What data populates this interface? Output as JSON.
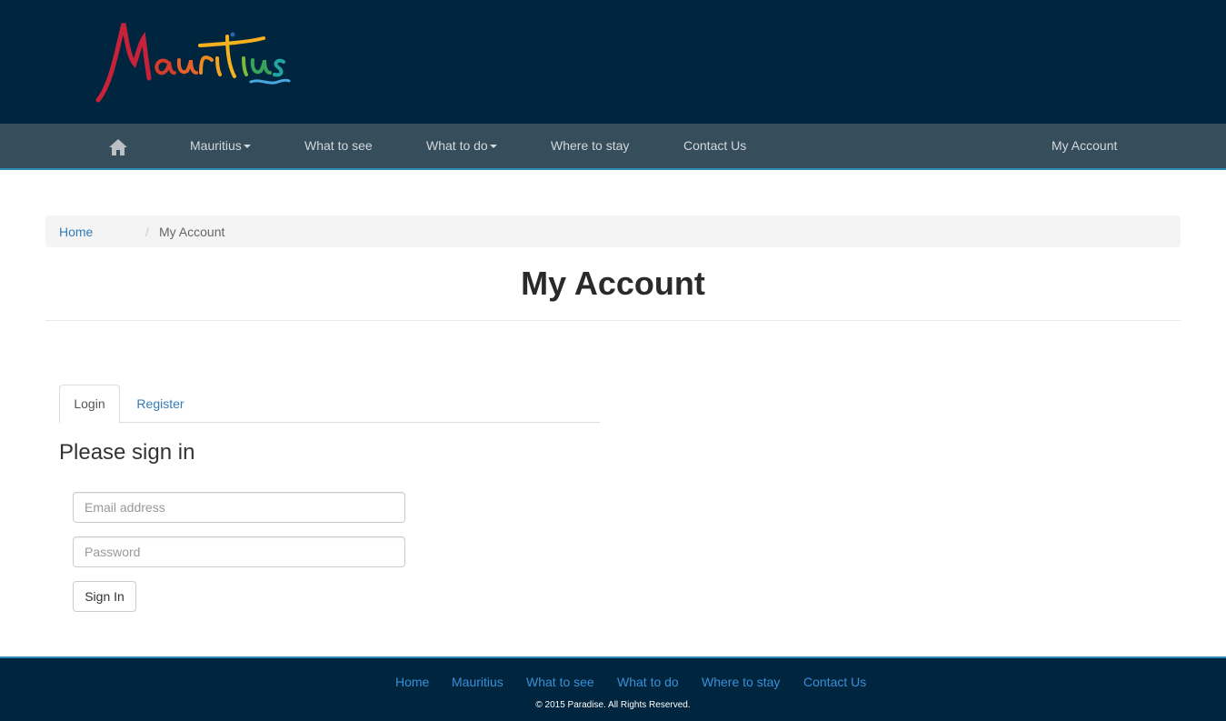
{
  "nav": {
    "items": [
      {
        "label": "Mauritius",
        "dropdown": true
      },
      {
        "label": "What to see",
        "dropdown": false
      },
      {
        "label": "What to do",
        "dropdown": true
      },
      {
        "label": "Where to stay",
        "dropdown": false
      },
      {
        "label": "Contact Us",
        "dropdown": false
      }
    ],
    "account": "My Account"
  },
  "breadcrumb": {
    "home": "Home",
    "separator": "/",
    "current": "My Account"
  },
  "page_title": "My Account",
  "tabs": [
    {
      "label": "Login",
      "active": true
    },
    {
      "label": "Register",
      "active": false
    }
  ],
  "login": {
    "heading": "Please sign in",
    "email_placeholder": "Email address",
    "password_placeholder": "Password",
    "submit_label": "Sign In"
  },
  "footer": {
    "links": [
      "Home",
      "Mauritius",
      "What to see",
      "What to do",
      "Where to stay",
      "Contact Us"
    ],
    "copyright": "© 2015 Paradise. All Rights Reserved."
  },
  "colors": {
    "header_bg": "#00263f",
    "nav_bg": "#364d5b",
    "link": "#337ab7",
    "footer_link": "#3b8fd6"
  },
  "icons": [
    "home-icon",
    "caret-down-icon",
    "mauritius-logo"
  ]
}
